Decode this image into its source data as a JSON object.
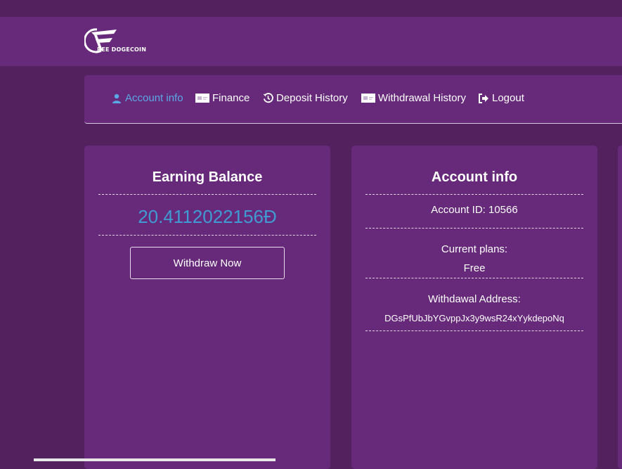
{
  "brand": {
    "logo_text": "REE DOGECOIN"
  },
  "nav": {
    "items": [
      {
        "label": "Account info",
        "icon": "user-icon",
        "active": true
      },
      {
        "label": "Finance",
        "icon": "money-icon"
      },
      {
        "label": "Deposit History",
        "icon": "history-icon"
      },
      {
        "label": "Withdrawal History",
        "icon": "money-icon"
      },
      {
        "label": "Logout",
        "icon": "logout-icon"
      }
    ]
  },
  "earning": {
    "title": "Earning Balance",
    "balance": "20.4112022156Đ",
    "withdraw_label": "Withdraw Now"
  },
  "account": {
    "title": "Account info",
    "account_id": "Account ID: 10566",
    "plans_label": "Current plans:",
    "plans_value": "Free",
    "address_label": "Withdawal Address:",
    "address_value": "DGsPfUbJbYGvppJx3y9wsR24xYykdepoNq"
  },
  "colors": {
    "background": "#53215e",
    "panel": "#67297a",
    "active_link": "#5aa8e6",
    "balance": "#3f9bd2"
  }
}
